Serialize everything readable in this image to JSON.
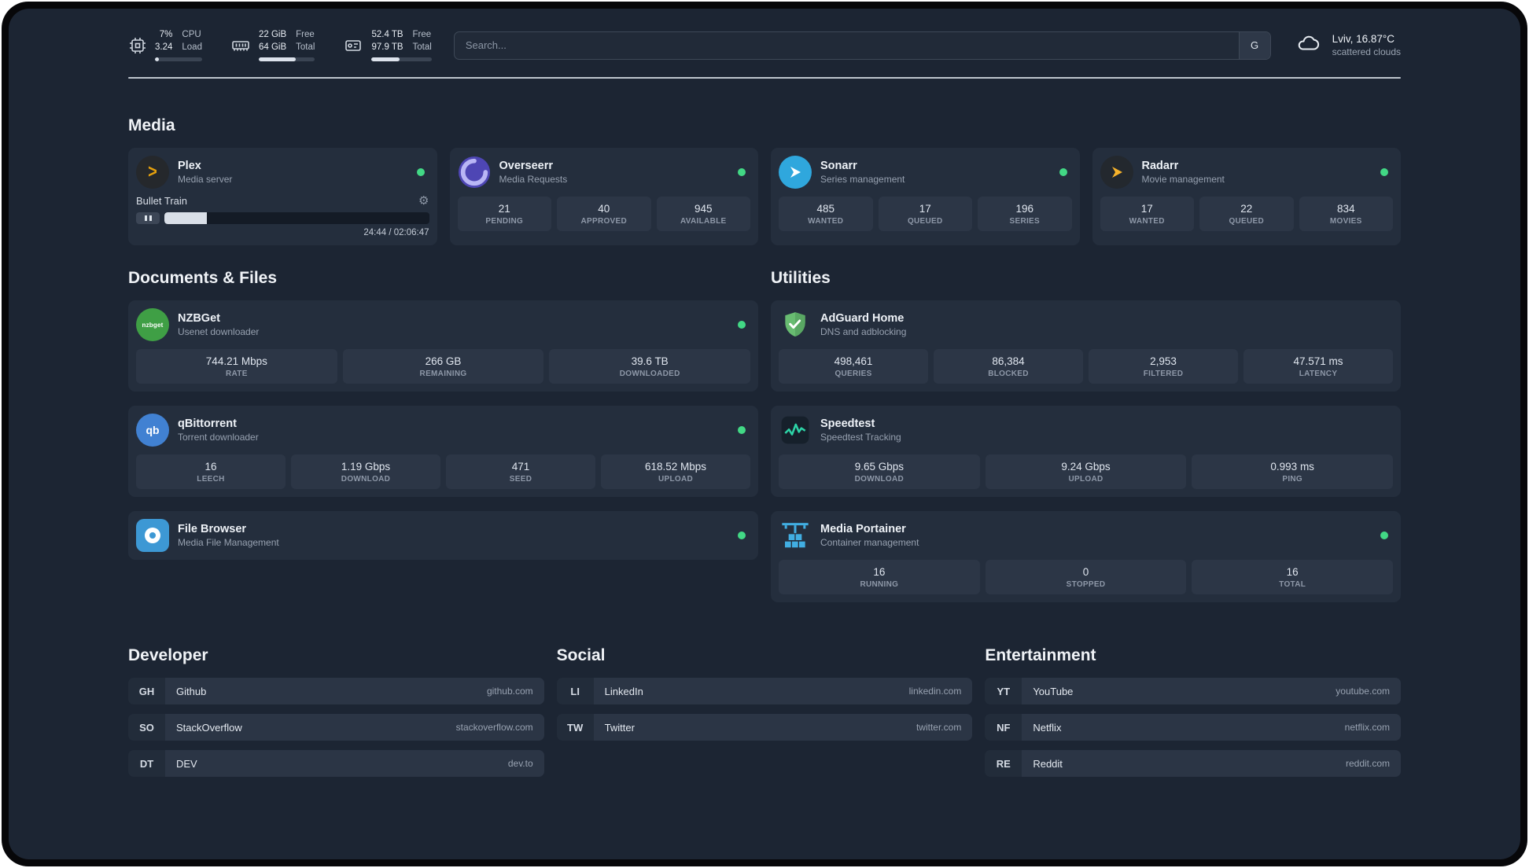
{
  "topbar": {
    "cpu": {
      "value": "7%",
      "load": "3.24",
      "label_top": "CPU",
      "label_bottom": "Load",
      "percent": 8
    },
    "memory": {
      "free": "22 GiB",
      "total": "64 GiB",
      "label_top": "Free",
      "label_bottom": "Total",
      "percent": 66
    },
    "disk": {
      "free": "52.4 TB",
      "total": "97.9 TB",
      "label_top": "Free",
      "label_bottom": "Total",
      "percent": 47
    },
    "search": {
      "placeholder": "Search...",
      "provider": "G"
    },
    "weather": {
      "location": "Lviv, 16.87°C",
      "condition": "scattered clouds"
    }
  },
  "media": {
    "title": "Media",
    "plex": {
      "name": "Plex",
      "subtitle": "Media server",
      "track": "Bullet Train",
      "time": "24:44 / 02:06:47",
      "progress_percent": 16
    },
    "overseerr": {
      "name": "Overseerr",
      "subtitle": "Media Requests",
      "stats": [
        {
          "value": "21",
          "label": "PENDING"
        },
        {
          "value": "40",
          "label": "APPROVED"
        },
        {
          "value": "945",
          "label": "AVAILABLE"
        }
      ]
    },
    "sonarr": {
      "name": "Sonarr",
      "subtitle": "Series management",
      "stats": [
        {
          "value": "485",
          "label": "WANTED"
        },
        {
          "value": "17",
          "label": "QUEUED"
        },
        {
          "value": "196",
          "label": "SERIES"
        }
      ]
    },
    "radarr": {
      "name": "Radarr",
      "subtitle": "Movie management",
      "stats": [
        {
          "value": "17",
          "label": "WANTED"
        },
        {
          "value": "22",
          "label": "QUEUED"
        },
        {
          "value": "834",
          "label": "MOVIES"
        }
      ]
    }
  },
  "documents": {
    "title": "Documents & Files",
    "nzbget": {
      "name": "NZBGet",
      "subtitle": "Usenet downloader",
      "stats": [
        {
          "value": "744.21 Mbps",
          "label": "RATE"
        },
        {
          "value": "266 GB",
          "label": "REMAINING"
        },
        {
          "value": "39.6 TB",
          "label": "DOWNLOADED"
        }
      ]
    },
    "qbittorrent": {
      "name": "qBittorrent",
      "subtitle": "Torrent downloader",
      "stats": [
        {
          "value": "16",
          "label": "LEECH"
        },
        {
          "value": "1.19 Gbps",
          "label": "DOWNLOAD"
        },
        {
          "value": "471",
          "label": "SEED"
        },
        {
          "value": "618.52 Mbps",
          "label": "UPLOAD"
        }
      ]
    },
    "filebrowser": {
      "name": "File Browser",
      "subtitle": "Media File Management"
    }
  },
  "utilities": {
    "title": "Utilities",
    "adguard": {
      "name": "AdGuard Home",
      "subtitle": "DNS and adblocking",
      "stats": [
        {
          "value": "498,461",
          "label": "QUERIES"
        },
        {
          "value": "86,384",
          "label": "BLOCKED"
        },
        {
          "value": "2,953",
          "label": "FILTERED"
        },
        {
          "value": "47.571 ms",
          "label": "LATENCY"
        }
      ]
    },
    "speedtest": {
      "name": "Speedtest",
      "subtitle": "Speedtest Tracking",
      "stats": [
        {
          "value": "9.65 Gbps",
          "label": "DOWNLOAD"
        },
        {
          "value": "9.24 Gbps",
          "label": "UPLOAD"
        },
        {
          "value": "0.993 ms",
          "label": "PING"
        }
      ]
    },
    "portainer": {
      "name": "Media Portainer",
      "subtitle": "Container management",
      "stats": [
        {
          "value": "16",
          "label": "RUNNING"
        },
        {
          "value": "0",
          "label": "STOPPED"
        },
        {
          "value": "16",
          "label": "TOTAL"
        }
      ]
    }
  },
  "bookmarks": {
    "developer": {
      "title": "Developer",
      "items": [
        {
          "abbr": "GH",
          "name": "Github",
          "domain": "github.com"
        },
        {
          "abbr": "SO",
          "name": "StackOverflow",
          "domain": "stackoverflow.com"
        },
        {
          "abbr": "DT",
          "name": "DEV",
          "domain": "dev.to"
        }
      ]
    },
    "social": {
      "title": "Social",
      "items": [
        {
          "abbr": "LI",
          "name": "LinkedIn",
          "domain": "linkedin.com"
        },
        {
          "abbr": "TW",
          "name": "Twitter",
          "domain": "twitter.com"
        }
      ]
    },
    "entertainment": {
      "title": "Entertainment",
      "items": [
        {
          "abbr": "YT",
          "name": "YouTube",
          "domain": "youtube.com"
        },
        {
          "abbr": "NF",
          "name": "Netflix",
          "domain": "netflix.com"
        },
        {
          "abbr": "RE",
          "name": "Reddit",
          "domain": "reddit.com"
        }
      ]
    }
  },
  "icon_glyphs": {
    "plex": ">",
    "nzbget": "nzbget",
    "qbittorrent": "qb"
  },
  "colors": {
    "status_green": "#42d885",
    "plex_amber": "#e5a00d",
    "background": "#1c2533",
    "card": "#242e3d"
  }
}
